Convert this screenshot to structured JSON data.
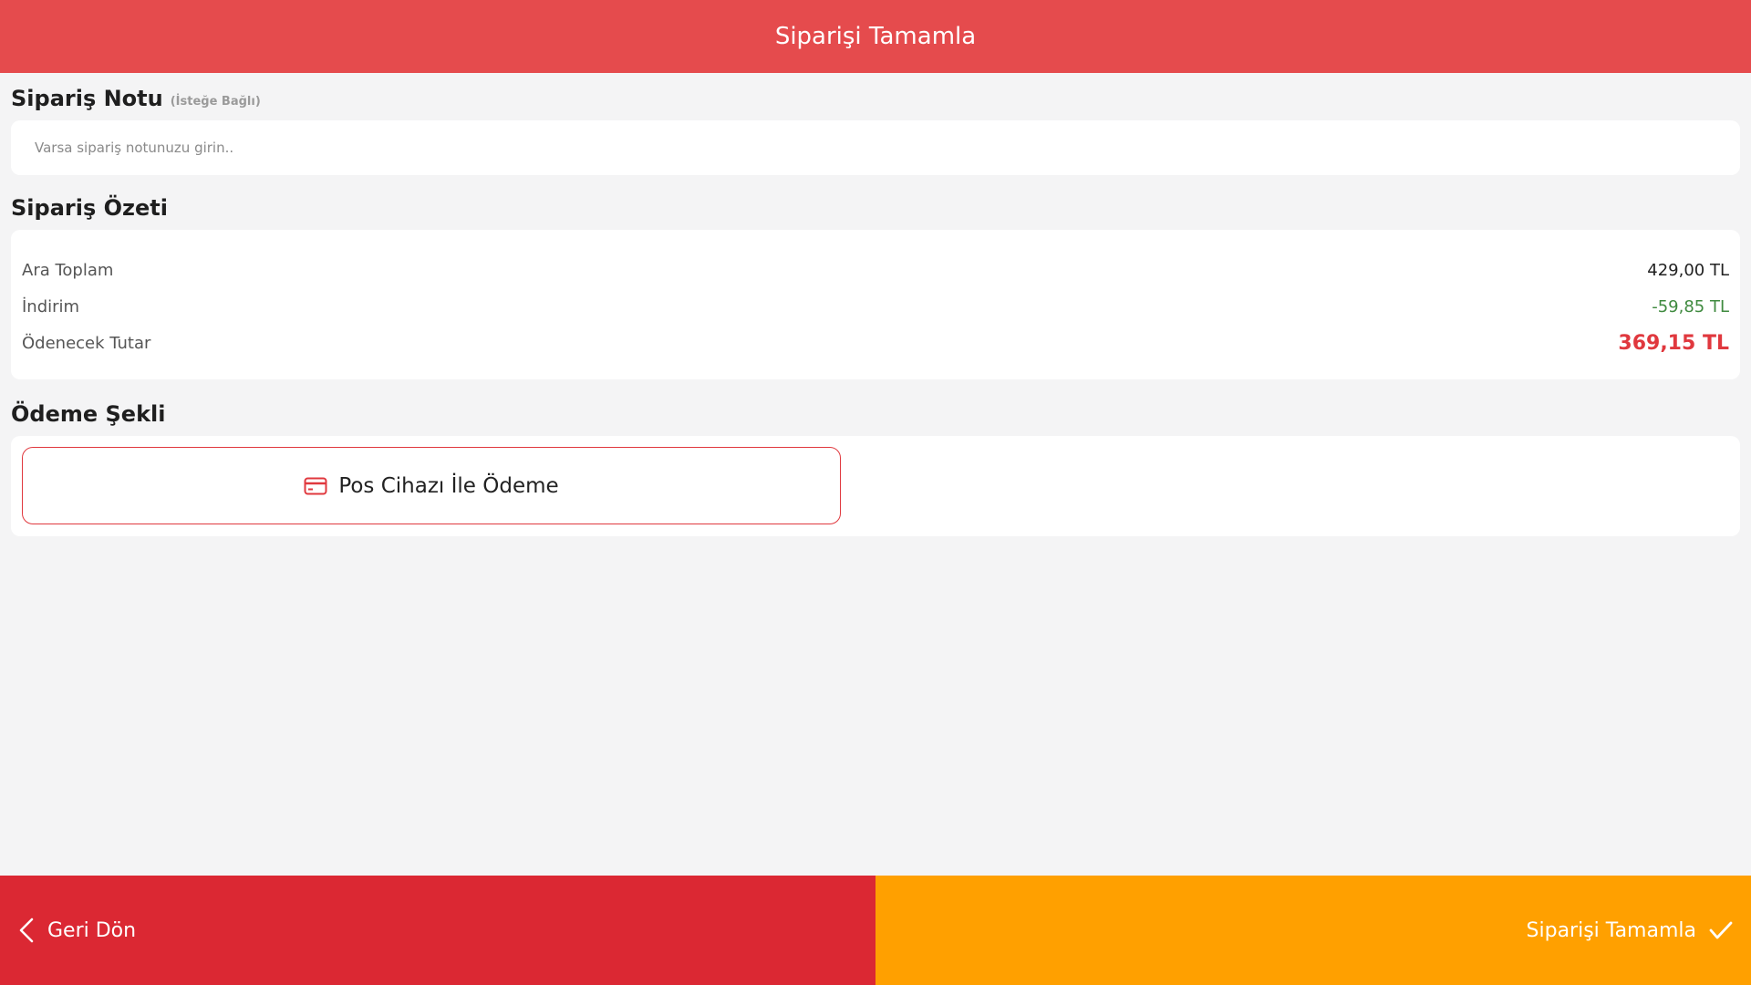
{
  "header": {
    "title": "Siparişi Tamamla"
  },
  "note": {
    "title": "Sipariş Notu",
    "subtitle": "(İsteğe Bağlı)",
    "placeholder": "Varsa sipariş notunuzu girin..",
    "value": ""
  },
  "summary": {
    "title": "Sipariş Özeti",
    "rows": [
      {
        "label": "Ara Toplam",
        "value": "429,00 TL"
      },
      {
        "label": "İndirim",
        "value": "-59,85 TL"
      },
      {
        "label": "Ödenecek Tutar",
        "value": "369,15 TL"
      }
    ]
  },
  "payment": {
    "title": "Ödeme Şekli",
    "option_label": "Pos Cihazı İle Ödeme",
    "option_icon": "credit-card-icon"
  },
  "footer": {
    "back_label": "Geri Dön",
    "back_icon": "chevron-left-icon",
    "complete_label": "Siparişi Tamamla",
    "complete_icon": "check-icon"
  },
  "colors": {
    "header": "#e54b4d",
    "back_button": "#db2833",
    "complete_button": "#ffa000",
    "discount": "#3f8a3f",
    "total": "#e0383e"
  }
}
